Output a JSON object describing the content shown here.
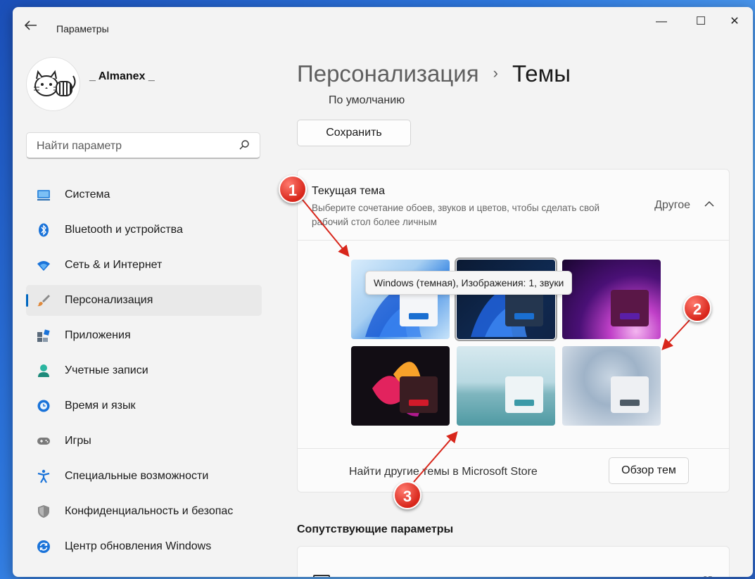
{
  "window": {
    "title": "Параметры",
    "controls": {
      "minimize": "—",
      "maximize": "☐",
      "close": "✕"
    }
  },
  "user": {
    "name": "_ Almanex _"
  },
  "search": {
    "placeholder": "Найти параметр"
  },
  "sidebar": {
    "items": [
      {
        "label": "Система",
        "icon": "display-icon",
        "color": "#3a8dde"
      },
      {
        "label": "Bluetooth и устройства",
        "icon": "bluetooth-icon",
        "color": "#1a73d9"
      },
      {
        "label": "Сеть & и Интернет",
        "icon": "wifi-icon",
        "color": "#1a73d9"
      },
      {
        "label": "Персонализация",
        "icon": "brush-icon",
        "color": "#e08a3c",
        "active": true
      },
      {
        "label": "Приложения",
        "icon": "apps-icon",
        "color": "#5a6a7a"
      },
      {
        "label": "Учетные записи",
        "icon": "person-icon",
        "color": "#2bb5a0"
      },
      {
        "label": "Время и язык",
        "icon": "globe-clock-icon",
        "color": "#1a73d9"
      },
      {
        "label": "Игры",
        "icon": "gamepad-icon",
        "color": "#7a7a7a"
      },
      {
        "label": "Специальные возможности",
        "icon": "accessibility-icon",
        "color": "#1a73d9"
      },
      {
        "label": "Конфиденциальность и безопас",
        "icon": "shield-icon",
        "color": "#8a8a8a"
      },
      {
        "label": "Центр обновления Windows",
        "icon": "update-icon",
        "color": "#1a73d9"
      }
    ]
  },
  "breadcrumb": {
    "parent": "Персонализация",
    "separator": "›",
    "current": "Темы"
  },
  "main": {
    "default_label": "По умолчанию",
    "save_label": "Сохранить",
    "current_theme": {
      "title": "Текущая тема",
      "description": "Выберите сочетание обоев, звуков и цветов, чтобы сделать свой рабочий стол более личным",
      "value": "Другое"
    },
    "tooltip": "Windows (темная), Изображения: 1, звуки",
    "themes": [
      {
        "name": "windows-light",
        "accent": "#1a6fd1",
        "swatch": "#f4f6f9"
      },
      {
        "name": "windows-dark",
        "accent": "#1a6fd1",
        "swatch": "#24364f",
        "selected": true
      },
      {
        "name": "glow",
        "accent": "#5a1fa8",
        "swatch": "#5a1747"
      },
      {
        "name": "captured-motion",
        "accent": "#d21a2a",
        "swatch": "#3a1d22"
      },
      {
        "name": "sunrise",
        "accent": "#3b9aa8",
        "swatch": "#eef4f6"
      },
      {
        "name": "flow",
        "accent": "#4e5b66",
        "swatch": "#eef0f3"
      }
    ],
    "store_text": "Найти другие темы в Microsoft Store",
    "browse_label": "Обзор тем",
    "related_title": "Сопутствующие параметры"
  },
  "annotations": {
    "badges": [
      "1",
      "2",
      "3"
    ],
    "color": "#d8261b"
  }
}
